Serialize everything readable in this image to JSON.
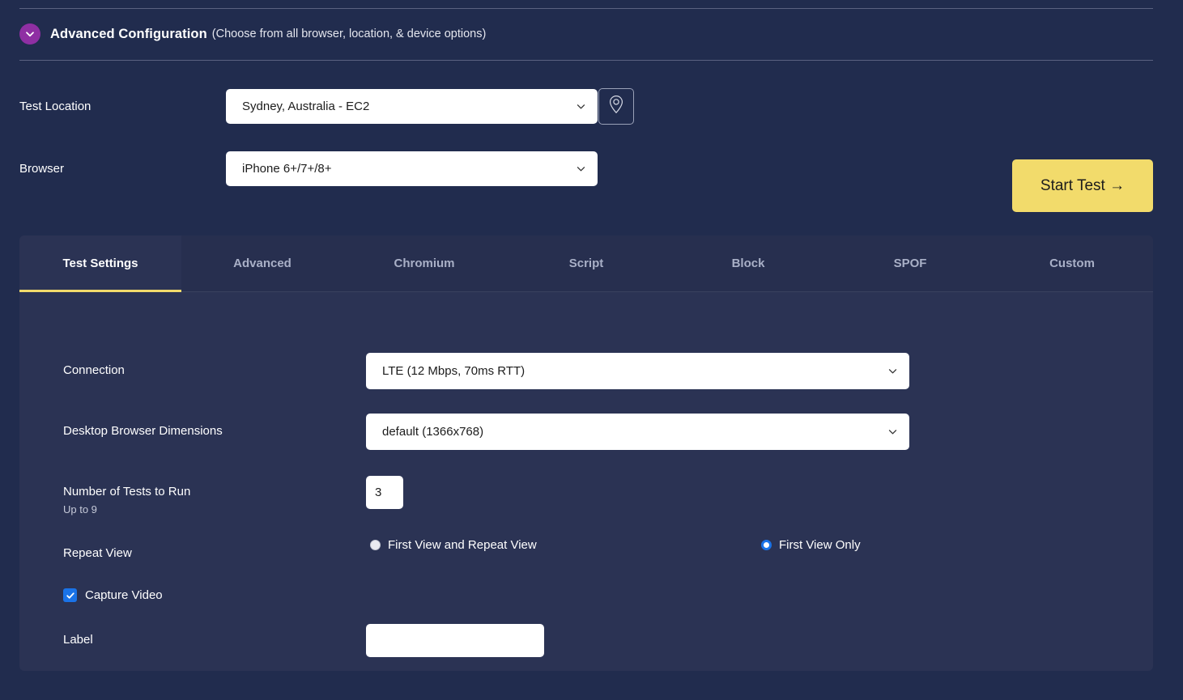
{
  "advanced": {
    "toggle_icon": "chevron-down-icon",
    "title": "Advanced Configuration",
    "subtitle": "(Choose from all browser, location, & device options)"
  },
  "test_location": {
    "label": "Test Location",
    "value": "Sydney, Australia - EC2",
    "pin_icon": "map-pin-icon",
    "chevron_icon": "chevron-down-icon"
  },
  "browser": {
    "label": "Browser",
    "value": "iPhone 6+/7+/8+",
    "chevron_icon": "chevron-down-icon"
  },
  "start_test": {
    "label": "Start Test →"
  },
  "tabs": [
    {
      "label": "Test Settings",
      "active": true
    },
    {
      "label": "Advanced",
      "active": false
    },
    {
      "label": "Chromium",
      "active": false
    },
    {
      "label": "Script",
      "active": false
    },
    {
      "label": "Block",
      "active": false
    },
    {
      "label": "SPOF",
      "active": false
    },
    {
      "label": "Custom",
      "active": false
    }
  ],
  "settings": {
    "connection": {
      "label": "Connection",
      "value": "LTE (12 Mbps, 70ms RTT)"
    },
    "dimensions": {
      "label": "Desktop Browser Dimensions",
      "value": "default (1366x768)"
    },
    "number_of_tests": {
      "label": "Number of Tests to Run",
      "sub_label": "Up to 9",
      "value": "3"
    },
    "repeat_view": {
      "label": "Repeat View",
      "options": [
        {
          "label": "First View and Repeat View",
          "selected": false
        },
        {
          "label": "First View Only",
          "selected": true
        }
      ]
    },
    "capture_video": {
      "label": "Capture Video",
      "checked": true
    },
    "label_field": {
      "label": "Label",
      "value": "",
      "placeholder": ""
    }
  },
  "colors": {
    "page_bg": "#212c4e",
    "panel_bg": "#2b3354",
    "tabstrip_bg": "#272f4f",
    "accent_yellow": "#f2db6b",
    "accent_purple": "#8f2fa3",
    "accent_blue": "#1a73e8"
  }
}
